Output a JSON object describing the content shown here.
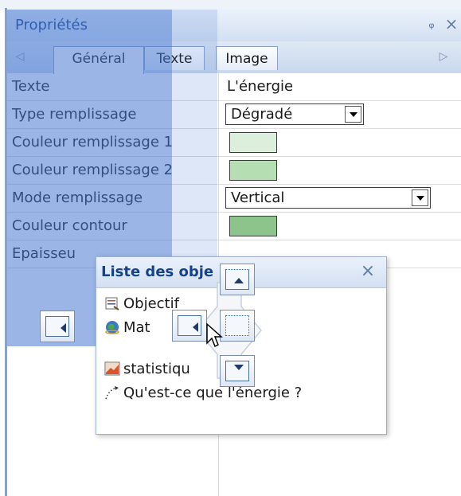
{
  "panel": {
    "title": "Propriétés",
    "pin_icon": "pin-icon",
    "close_icon": "close-icon",
    "tabs": [
      {
        "label": "Général",
        "active": true
      },
      {
        "label": "Texte",
        "active": false
      },
      {
        "label": "Image",
        "active": false
      }
    ],
    "rows": [
      {
        "label": "Texte",
        "value": "L'énergie"
      },
      {
        "label": "Type remplissage",
        "value": "Dégradé"
      },
      {
        "label": "Couleur remplissage 1",
        "color": "#dcefdc"
      },
      {
        "label": "Couleur remplissage 2",
        "color": "#b5dfb2"
      },
      {
        "label": "Mode remplissage",
        "value": "Vertical"
      },
      {
        "label": "Couleur contour",
        "color": "#8dc48c"
      },
      {
        "label": "Epaisseu"
      }
    ]
  },
  "object_list": {
    "title": "Liste des obje",
    "close_icon": "close-icon",
    "items": [
      {
        "label": "Objectif",
        "icon": "objective-icon"
      },
      {
        "label": "Mat",
        "icon": "globe-icon"
      },
      {
        "label": "statistiqu",
        "icon": "chart-icon"
      },
      {
        "label": "Qu'est-ce que l'énergie ?",
        "icon": "dotted-arrow-icon"
      }
    ]
  },
  "colors": {
    "accent": "#15428b",
    "dock_preview": "#4678d2",
    "border": "#8aa2c8"
  }
}
